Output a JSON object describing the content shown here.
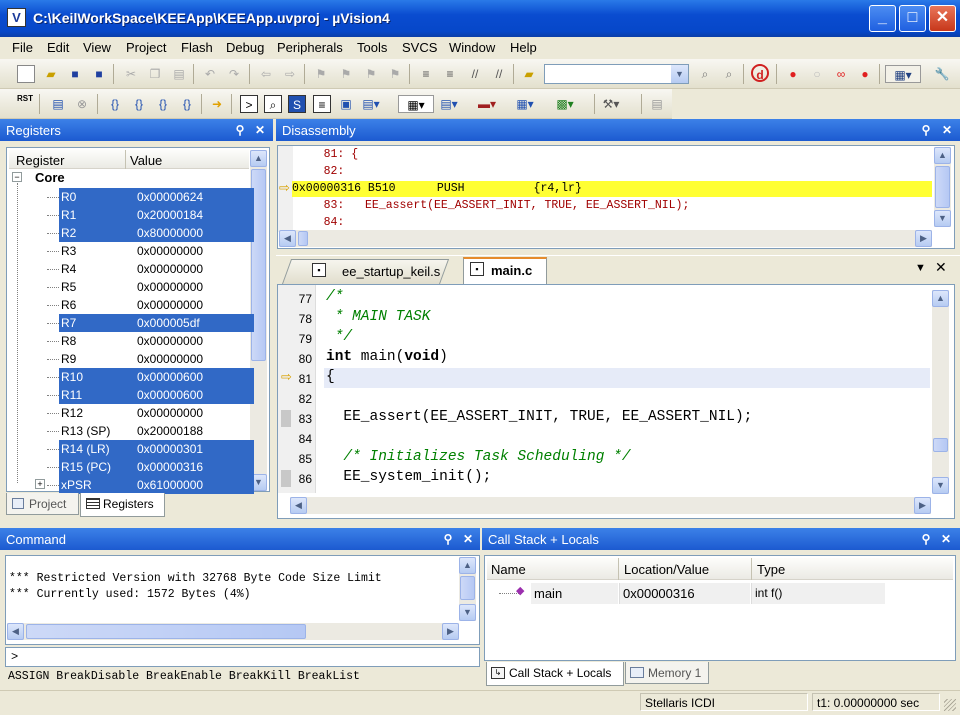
{
  "window": {
    "title": "C:\\KeilWorkSpace\\KEEApp\\KEEApp.uvproj - µVision4",
    "app_icon": "µV-logo",
    "min": "_",
    "max": "□",
    "close": "✕"
  },
  "menu": [
    "File",
    "Edit",
    "View",
    "Project",
    "Flash",
    "Debug",
    "Peripherals",
    "Tools",
    "SVCS",
    "Window",
    "Help"
  ],
  "registers": {
    "title": "Registers",
    "col_register": "Register",
    "col_value": "Value",
    "group": "Core",
    "rows": [
      {
        "name": "R0",
        "value": "0x00000624",
        "selected": true
      },
      {
        "name": "R1",
        "value": "0x20000184",
        "selected": true
      },
      {
        "name": "R2",
        "value": "0x80000000",
        "selected": true
      },
      {
        "name": "R3",
        "value": "0x00000000",
        "selected": false
      },
      {
        "name": "R4",
        "value": "0x00000000",
        "selected": false
      },
      {
        "name": "R5",
        "value": "0x00000000",
        "selected": false
      },
      {
        "name": "R6",
        "value": "0x00000000",
        "selected": false
      },
      {
        "name": "R7",
        "value": "0x000005df",
        "selected": true
      },
      {
        "name": "R8",
        "value": "0x00000000",
        "selected": false
      },
      {
        "name": "R9",
        "value": "0x00000000",
        "selected": false
      },
      {
        "name": "R10",
        "value": "0x00000600",
        "selected": true
      },
      {
        "name": "R11",
        "value": "0x00000600",
        "selected": true
      },
      {
        "name": "R12",
        "value": "0x00000000",
        "selected": false
      },
      {
        "name": "R13 (SP)",
        "value": "0x20000188",
        "selected": false
      },
      {
        "name": "R14 (LR)",
        "value": "0x00000301",
        "selected": true
      },
      {
        "name": "R15 (PC)",
        "value": "0x00000316",
        "selected": true
      },
      {
        "name": "xPSR",
        "value": "0x61000000",
        "selected": true
      }
    ],
    "tab_project": "Project",
    "tab_registers": "Registers"
  },
  "disassembly": {
    "title": "Disassembly",
    "lines": [
      {
        "text": "    81: {",
        "current": false
      },
      {
        "text": "    82:",
        "current": false
      },
      {
        "text": "0x00000316 B510      PUSH          {r4,lr}",
        "current": true
      },
      {
        "text": "    83:   EE_assert(EE_ASSERT_INIT, TRUE, EE_ASSERT_NIL);",
        "current": false
      },
      {
        "text": "    84:",
        "current": false
      }
    ]
  },
  "editor": {
    "tabs": [
      {
        "label": "ee_startup_keil.s",
        "active": false
      },
      {
        "label": "main.c",
        "active": true
      }
    ],
    "lines": [
      {
        "num": "77",
        "code": "/*",
        "style": "cm"
      },
      {
        "num": "78",
        "code": " * MAIN TASK",
        "style": "cm"
      },
      {
        "num": "79",
        "code": " */",
        "style": "cm"
      },
      {
        "num": "80",
        "code": "int main(void)",
        "style": "kw"
      },
      {
        "num": "81",
        "code": "{",
        "style": "cur"
      },
      {
        "num": "82",
        "code": "",
        "style": ""
      },
      {
        "num": "83",
        "code": "  EE_assert(EE_ASSERT_INIT, TRUE, EE_ASSERT_NIL);",
        "style": ""
      },
      {
        "num": "84",
        "code": "",
        "style": ""
      },
      {
        "num": "85",
        "code": "  /* Initializes Task Scheduling */",
        "style": "cm"
      },
      {
        "num": "86",
        "code": "  EE_system_init();",
        "style": ""
      }
    ]
  },
  "command": {
    "title": "Command",
    "output": [
      "*** Restricted Version with 32768 Byte Code Size Limit",
      "*** Currently used: 1572 Bytes (4%)"
    ],
    "prompt": ">",
    "hint": "ASSIGN BreakDisable BreakEnable BreakKill BreakList"
  },
  "callstack": {
    "title": "Call Stack + Locals",
    "col_name": "Name",
    "col_location": "Location/Value",
    "col_type": "Type",
    "row": {
      "name": "main",
      "location": "0x00000316",
      "type": "int f()"
    },
    "tab_callstack": "Call Stack + Locals",
    "tab_memory": "Memory 1"
  },
  "status": {
    "target": "Stellaris ICDI",
    "time": "t1: 0.00000000 sec"
  },
  "colors": {
    "selection": "#3169c6",
    "current_line": "#ffff33",
    "pane_header": "#2a66d8"
  }
}
